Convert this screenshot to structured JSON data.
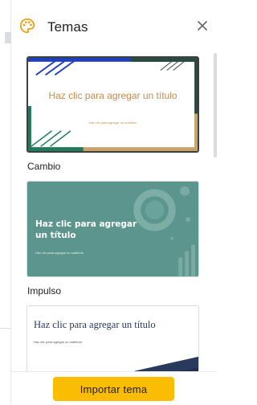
{
  "panel": {
    "title": "Temas",
    "icons": {
      "header": "palette-icon",
      "close": "close-icon"
    }
  },
  "themes": [
    {
      "name": "Cambio",
      "selected": true,
      "preview_title": "Haz clic para agregar un título",
      "preview_subtitle": "Haz clic para agregar un subtítulo",
      "colors": {
        "background": "#ffffff",
        "accent1": "#1f3fbf",
        "accent2": "#2b4a3e",
        "accent3": "#c9a26b",
        "accent4": "#1e7a5a",
        "text": "#c98a4b"
      }
    },
    {
      "name": "Impulso",
      "selected": false,
      "preview_title": "Haz clic para agregar un título",
      "preview_subtitle": "Haz clic para agregar un subtítulo",
      "colors": {
        "background": "#5b958e",
        "text": "#ffffff"
      }
    },
    {
      "name": "",
      "selected": false,
      "preview_title": "Haz clic para agregar un título",
      "preview_subtitle": "Haz clic para agregar un subtítulo",
      "colors": {
        "background": "#ffffff",
        "accent": "#2a3a5c",
        "text": "#2a3a5c"
      }
    }
  ],
  "footer": {
    "import_button_label": "Importar tema",
    "import_button_color": "#fbbc04"
  }
}
